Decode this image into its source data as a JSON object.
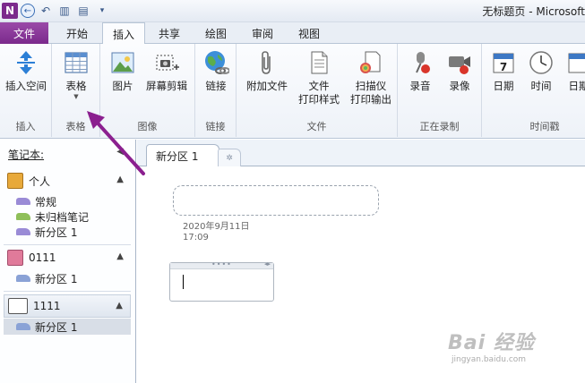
{
  "window": {
    "title": "无标题页 - Microsoft"
  },
  "tabs": {
    "file": "文件",
    "items": [
      {
        "label": "开始"
      },
      {
        "label": "插入"
      },
      {
        "label": "共享"
      },
      {
        "label": "绘图"
      },
      {
        "label": "审阅"
      },
      {
        "label": "视图"
      }
    ],
    "active": "插入"
  },
  "ribbon": {
    "groups": [
      {
        "label": "插入",
        "buttons": [
          {
            "label": "插入空间",
            "icon": "insert-space-icon"
          }
        ]
      },
      {
        "label": "表格",
        "buttons": [
          {
            "label": "表格",
            "icon": "table-icon",
            "has_dropdown": true
          }
        ]
      },
      {
        "label": "图像",
        "buttons": [
          {
            "label": "图片",
            "icon": "picture-icon"
          },
          {
            "label": "屏幕剪辑",
            "icon": "screen-clip-icon"
          }
        ]
      },
      {
        "label": "链接",
        "buttons": [
          {
            "label": "链接",
            "icon": "link-globe-icon"
          }
        ]
      },
      {
        "label": "文件",
        "buttons": [
          {
            "label": "附加文件",
            "icon": "paperclip-icon"
          },
          {
            "label": "文件\n打印样式",
            "icon": "file-printout-icon"
          },
          {
            "label": "扫描仪\n打印输出",
            "icon": "scanner-icon"
          }
        ]
      },
      {
        "label": "正在录制",
        "buttons": [
          {
            "label": "录音",
            "icon": "microphone-icon"
          },
          {
            "label": "录像",
            "icon": "video-camera-icon"
          }
        ]
      },
      {
        "label": "时间戳",
        "buttons": [
          {
            "label": "日期",
            "icon": "calendar-icon",
            "calendar_day": "7"
          },
          {
            "label": "时间",
            "icon": "clock-icon"
          },
          {
            "label": "日期",
            "icon": "calendar-clock-icon"
          }
        ]
      }
    ]
  },
  "nav": {
    "title": "笔记本:",
    "notebooks": [
      {
        "name": "个人",
        "color": "#e8a93a",
        "sections": [
          {
            "name": "常规",
            "color": "#9a8bd6"
          },
          {
            "name": "未归档笔记",
            "color": "#8fbf5a"
          },
          {
            "name": "新分区 1",
            "color": "#9a8bd6"
          }
        ]
      },
      {
        "name": "0111",
        "color": "#e07a9a",
        "sections": [
          {
            "name": "新分区 1",
            "color": "#8aa2d6"
          }
        ]
      },
      {
        "name": "1111",
        "color": "#c9a46a",
        "sections": [
          {
            "name": "新分区 1",
            "color": "#8aa2d6"
          }
        ],
        "selected": true
      }
    ]
  },
  "section_tabs": {
    "active": "新分区 1"
  },
  "page": {
    "date": "2020年9月11日",
    "time": "17:09"
  },
  "watermark": {
    "line1": "Bai 经验",
    "line2": "jingyan.baidu.com"
  },
  "colors": {
    "accent": "#7b2a8c",
    "annotation_arrow": "#8b1f8f"
  }
}
